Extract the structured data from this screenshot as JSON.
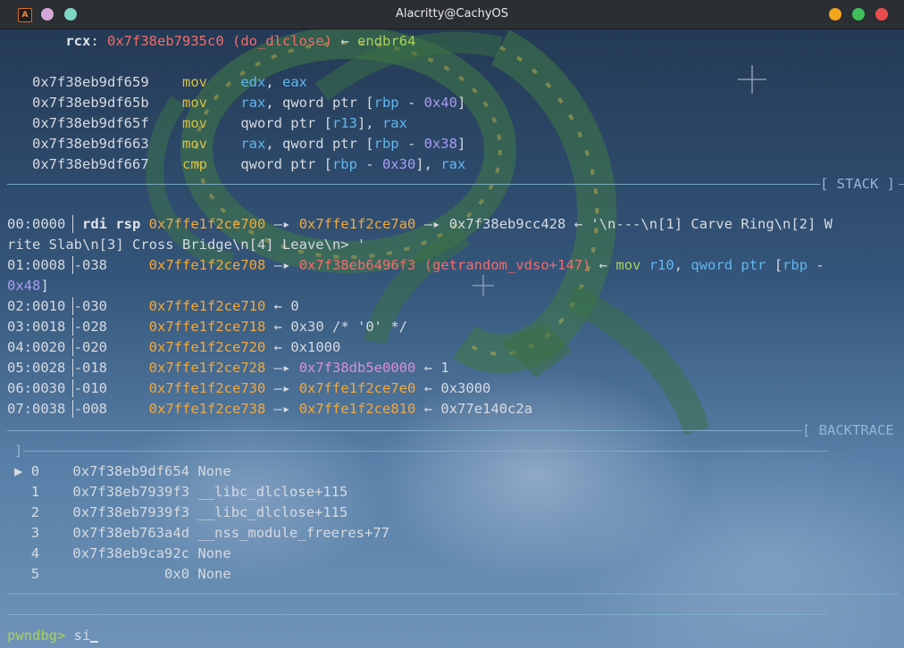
{
  "window": {
    "title": "Alacritty@CachyOS",
    "app_icon_letter": "A",
    "left_dots": [
      "#d5a6d8",
      "#7ed6c6"
    ],
    "right_dots": [
      "#f3a51b",
      "#3fbf5b",
      "#ea4d4d"
    ]
  },
  "registers": {
    "rcx": {
      "name": "rcx",
      "colon": ":",
      "addr": "0x7f38eb7935c0",
      "sym": "(do_dlclose)",
      "arrow": "←",
      "insn": "endbr64"
    }
  },
  "disasm": [
    {
      "addr": "0x7f38eb9df659",
      "mnem": "mov",
      "ops": [
        [
          "edx",
          "reg"
        ],
        [
          ", ",
          "p"
        ],
        [
          "eax",
          "reg"
        ]
      ]
    },
    {
      "addr": "0x7f38eb9df65b",
      "mnem": "mov",
      "ops": [
        [
          "rax",
          "reg"
        ],
        [
          ", qword ptr [",
          "p"
        ],
        [
          "rbp",
          "reg"
        ],
        [
          " - ",
          "p"
        ],
        [
          "0x40",
          "num"
        ],
        [
          "]",
          "p"
        ]
      ]
    },
    {
      "addr": "0x7f38eb9df65f",
      "mnem": "mov",
      "ops": [
        [
          "qword ptr [",
          "p"
        ],
        [
          "r13",
          "reg"
        ],
        [
          "], ",
          "p"
        ],
        [
          "rax",
          "reg"
        ]
      ]
    },
    {
      "addr": "0x7f38eb9df663",
      "mnem": "mov",
      "ops": [
        [
          "rax",
          "reg"
        ],
        [
          ", qword ptr [",
          "p"
        ],
        [
          "rbp",
          "reg"
        ],
        [
          " - ",
          "p"
        ],
        [
          "0x38",
          "num"
        ],
        [
          "]",
          "p"
        ]
      ]
    },
    {
      "addr": "0x7f38eb9df667",
      "mnem": "cmp",
      "ops": [
        [
          "qword ptr [",
          "p"
        ],
        [
          "rbp",
          "reg"
        ],
        [
          " - ",
          "p"
        ],
        [
          "0x30",
          "num"
        ],
        [
          "], ",
          "p"
        ],
        [
          "rax",
          "reg"
        ]
      ]
    }
  ],
  "headers": {
    "stack": "[ STACK ]",
    "backtrace": "[ BACKTRACE",
    "bt_close": "]"
  },
  "stack": {
    "row0": {
      "idx": "00:0000",
      "regs": "rdi rsp",
      "a1": "0x7ffe1f2ce700",
      "arrow1": "—▸",
      "a2": "0x7ffe1f2ce7a0",
      "arrow2": "—▸",
      "a3": "0x7f38eb9cc428",
      "arrow3": "←",
      "str1": "'\\n---\\n[1] Carve Ring\\n[2] W",
      "str2": "rite Slab\\n[3] Cross Bridge\\n[4] Leave\\n> '"
    },
    "row1": {
      "idx": "01:0008",
      "off": "-038",
      "a1": "0x7ffe1f2ce708",
      "arrow1": "—▸",
      "a2": "0x7f38eb6496f3",
      "sym": "(getrandom_vdso+147)",
      "arrow2": "←",
      "mnem": "mov",
      "r1": "r10",
      "p1": ", ",
      "kw": "qword ptr",
      "p2": " [",
      "r2": "rbp",
      "p3": " -",
      "num": "0x48",
      "p4": "]"
    },
    "row2": {
      "idx": "02:0010",
      "off": "-030",
      "a1": "0x7ffe1f2ce710",
      "arrow": "←",
      "val": "0"
    },
    "row3": {
      "idx": "03:0018",
      "off": "-028",
      "a1": "0x7ffe1f2ce718",
      "arrow": "←",
      "val": "0x30 /* '0' */"
    },
    "row4": {
      "idx": "04:0020",
      "off": "-020",
      "a1": "0x7ffe1f2ce720",
      "arrow": "←",
      "val": "0x1000"
    },
    "row5": {
      "idx": "05:0028",
      "off": "-018",
      "a1": "0x7ffe1f2ce728",
      "arrow1": "—▸",
      "a2": "0x7f38db5e0000",
      "arrow2": "←",
      "val": "1"
    },
    "row6": {
      "idx": "06:0030",
      "off": "-010",
      "a1": "0x7ffe1f2ce730",
      "arrow1": "—▸",
      "a2": "0x7ffe1f2ce7e0",
      "arrow2": "←",
      "val": "0x3000"
    },
    "row7": {
      "idx": "07:0038",
      "off": "-008",
      "a1": "0x7ffe1f2ce738",
      "arrow1": "—▸",
      "a2": "0x7ffe1f2ce810",
      "arrow2": "←",
      "val": "0x77e140c2a"
    }
  },
  "backtrace": [
    {
      "marker": "▶",
      "num": "0",
      "addr": "0x7f38eb9df654",
      "sym": "None"
    },
    {
      "marker": " ",
      "num": "1",
      "addr": "0x7f38eb7939f3",
      "sym": "__libc_dlclose+115"
    },
    {
      "marker": " ",
      "num": "2",
      "addr": "0x7f38eb7939f3",
      "sym": "__libc_dlclose+115"
    },
    {
      "marker": " ",
      "num": "3",
      "addr": "0x7f38eb763a4d",
      "sym": "__nss_module_freeres+77"
    },
    {
      "marker": " ",
      "num": "4",
      "addr": "0x7f38eb9ca92c",
      "sym": "None"
    },
    {
      "marker": " ",
      "num": "5",
      "addr": "0x0",
      "sym": "None"
    }
  ],
  "prompt": {
    "label": "pwndbg>",
    "input": "si"
  }
}
